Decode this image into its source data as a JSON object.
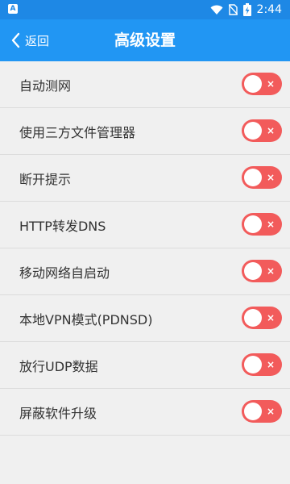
{
  "status_bar": {
    "left_icon_letter": "A",
    "time": "2:44",
    "battery_glyph": "⚡"
  },
  "header": {
    "back_label": "返回",
    "title": "高级设置"
  },
  "settings": [
    {
      "label": "自动测网",
      "enabled": false
    },
    {
      "label": "使用三方文件管理器",
      "enabled": false
    },
    {
      "label": "断开提示",
      "enabled": false
    },
    {
      "label": "HTTP转发DNS",
      "enabled": false
    },
    {
      "label": "移动网络自启动",
      "enabled": false
    },
    {
      "label": "本地VPN模式(PDNSD)",
      "enabled": false
    },
    {
      "label": "放行UDP数据",
      "enabled": false
    },
    {
      "label": "屏蔽软件升级",
      "enabled": false
    }
  ],
  "toggle_off_glyph": "×",
  "colors": {
    "status_bar": "#1e88e5",
    "nav_bar": "#2196f3",
    "toggle_off": "#f25b5b",
    "background": "#f0f0f0"
  }
}
